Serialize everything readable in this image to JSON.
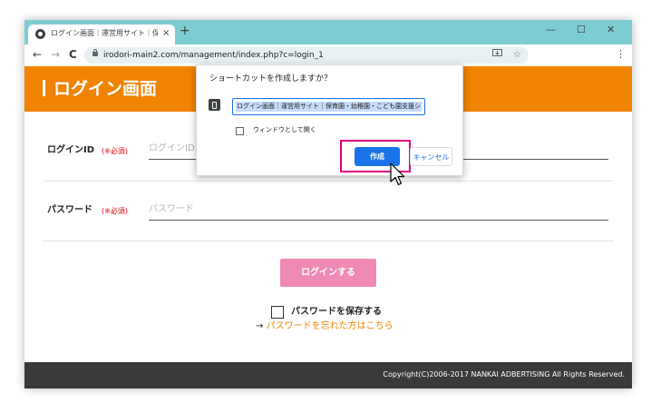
{
  "browser": {
    "tab_title": "ログイン画面｜運営用サイト｜保育園・幼稚園・こども園支援システム",
    "tab_close": "×",
    "new_tab": "+",
    "minimize": "—",
    "maximize": "☐",
    "close": "✕",
    "back": "←",
    "forward": "→",
    "reload": "C",
    "url": "irodori-main2.com/management/index.php?c=login_1",
    "install_icon": "install-app-icon",
    "star": "☆",
    "menu": "⋮"
  },
  "page": {
    "title": "ログイン画面",
    "login_id_label": "ログインID",
    "login_id_required": "(※必須)",
    "login_id_placeholder": "ログインID",
    "password_label": "パスワード",
    "password_required": "(※必須)",
    "password_placeholder": "パスワード",
    "login_button": "ログインする",
    "save_password_label": "パスワードを保存する",
    "forgot_arrow": "→",
    "forgot_link": "パスワードを忘れた方はこちら",
    "footer": "Copyright(C)2006-2017 NANKAI ADBERTISING All Rights Reserved."
  },
  "dialog": {
    "title": "ショートカットを作成しますか？",
    "name_value": "ログイン画面｜運営用サイト｜保育園・幼稚園・こども園支援シ",
    "open_as_window": "ウィンドウとして開く",
    "create_button": "作成",
    "cancel_button": "キャンセル"
  },
  "colors": {
    "tab_strip": "#7ccdd1",
    "brand_orange": "#f08300",
    "login_button": "#ee8ab4",
    "highlight": "#e5007f",
    "primary_blue": "#1a73e8",
    "footer": "#3a3a3a"
  }
}
